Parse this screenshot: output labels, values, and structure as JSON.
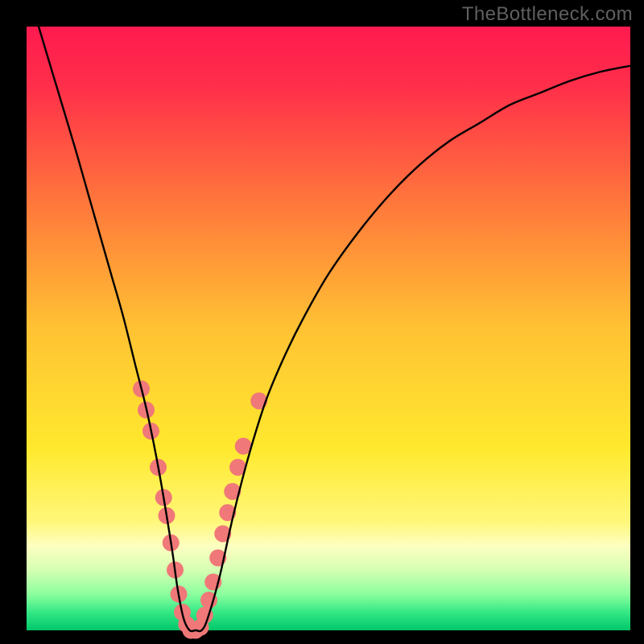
{
  "watermark": "TheBottleneck.com",
  "chart_data": {
    "type": "line",
    "title": "",
    "xlabel": "",
    "ylabel": "",
    "xlim": [
      0,
      100
    ],
    "ylim": [
      0,
      100
    ],
    "grid": false,
    "legend": false,
    "gradient_stops": [
      {
        "offset": 0,
        "color": "#ff1a4f"
      },
      {
        "offset": 0.1,
        "color": "#ff2f4a"
      },
      {
        "offset": 0.3,
        "color": "#ff7a3b"
      },
      {
        "offset": 0.5,
        "color": "#ffc233"
      },
      {
        "offset": 0.7,
        "color": "#ffe92e"
      },
      {
        "offset": 0.82,
        "color": "#fff77a"
      },
      {
        "offset": 0.86,
        "color": "#fdffc0"
      },
      {
        "offset": 0.9,
        "color": "#d6ffb3"
      },
      {
        "offset": 0.94,
        "color": "#8cff9e"
      },
      {
        "offset": 0.97,
        "color": "#35e885"
      },
      {
        "offset": 1.0,
        "color": "#00c76a"
      }
    ],
    "series": [
      {
        "name": "bottleneck-curve",
        "x": [
          0,
          2,
          5,
          8,
          10,
          12,
          14,
          16,
          18,
          20,
          22,
          24,
          25,
          26,
          27,
          28,
          29,
          30,
          32,
          34,
          36,
          38,
          40,
          43,
          46,
          50,
          55,
          60,
          65,
          70,
          75,
          80,
          85,
          90,
          95,
          100
        ],
        "y": [
          107,
          100,
          90,
          80,
          73,
          66,
          59,
          52,
          44,
          36,
          26,
          14,
          7,
          2,
          0,
          0,
          0,
          2,
          9,
          18,
          26,
          33,
          39,
          46,
          52,
          59,
          66,
          72,
          77,
          81,
          84,
          87,
          89,
          91,
          92.5,
          93.5
        ]
      }
    ],
    "markers": [
      {
        "x": 19.0,
        "y": 40.0
      },
      {
        "x": 19.8,
        "y": 36.5
      },
      {
        "x": 20.6,
        "y": 33.0
      },
      {
        "x": 21.8,
        "y": 27.0
      },
      {
        "x": 22.7,
        "y": 22.0
      },
      {
        "x": 23.2,
        "y": 19.0
      },
      {
        "x": 23.9,
        "y": 14.5
      },
      {
        "x": 24.6,
        "y": 10.0
      },
      {
        "x": 25.2,
        "y": 6.0
      },
      {
        "x": 25.8,
        "y": 3.0
      },
      {
        "x": 26.5,
        "y": 1.0
      },
      {
        "x": 27.2,
        "y": 0.0
      },
      {
        "x": 28.0,
        "y": 0.0
      },
      {
        "x": 28.8,
        "y": 0.5
      },
      {
        "x": 29.5,
        "y": 2.5
      },
      {
        "x": 30.2,
        "y": 5.0
      },
      {
        "x": 30.9,
        "y": 8.0
      },
      {
        "x": 31.7,
        "y": 12.0
      },
      {
        "x": 32.5,
        "y": 16.0
      },
      {
        "x": 33.3,
        "y": 19.5
      },
      {
        "x": 34.1,
        "y": 23.0
      },
      {
        "x": 35.0,
        "y": 27.0
      },
      {
        "x": 35.9,
        "y": 30.5
      },
      {
        "x": 38.5,
        "y": 38.0
      }
    ],
    "marker_style": {
      "r": 10.5,
      "fill": "#f07878",
      "stroke": "none"
    }
  }
}
